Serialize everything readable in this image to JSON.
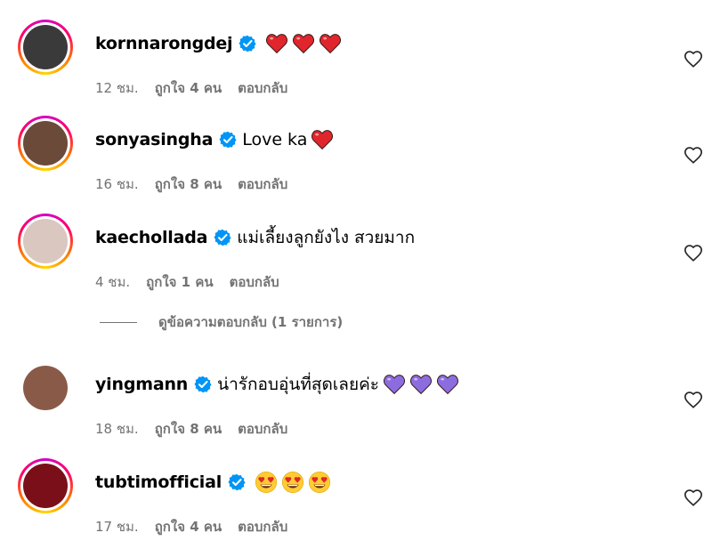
{
  "comments": [
    {
      "username": "kornnarongdej",
      "text": "",
      "emoji": "red-heart",
      "emoji_count": 3,
      "time": "12 ชม.",
      "likes": "ถูกใจ 4 คน",
      "reply": "ตอบกลับ",
      "ring": true,
      "avatar_color": "#3a3a3a"
    },
    {
      "username": "sonyasingha",
      "text": "Love ka",
      "emoji": "red-heart",
      "emoji_count": 1,
      "time": "16 ชม.",
      "likes": "ถูกใจ 8 คน",
      "reply": "ตอบกลับ",
      "ring": true,
      "avatar_color": "#6b4a3a"
    },
    {
      "username": "kaechollada",
      "text": "แม่เลี้ยงลูกยังไง สวยมาก",
      "emoji": "",
      "emoji_count": 0,
      "time": "4 ชม.",
      "likes": "ถูกใจ 1 คน",
      "reply": "ตอบกลับ",
      "ring": true,
      "avatar_color": "#d9c7c0"
    },
    {
      "username": "yingmann",
      "text": "น่ารักอบอุ่นที่สุดเลยค่ะ",
      "emoji": "purple-heart",
      "emoji_count": 3,
      "time": "18 ชม.",
      "likes": "ถูกใจ 8 คน",
      "reply": "ตอบกลับ",
      "ring": false,
      "avatar_color": "#8a5a48"
    },
    {
      "username": "tubtimofficial",
      "text": "",
      "emoji": "heart-eyes",
      "emoji_count": 3,
      "time": "17 ชม.",
      "likes": "ถูกใจ 4 คน",
      "reply": "ตอบกลับ",
      "ring": true,
      "avatar_color": "#7a0f1a"
    }
  ],
  "view_replies": "ดูข้อความตอบกลับ (1 รายการ)",
  "colors": {
    "verified": "#0095f6",
    "meta": "#737373",
    "red_heart": "#e0262c",
    "purple_heart": "#8b6de0"
  }
}
